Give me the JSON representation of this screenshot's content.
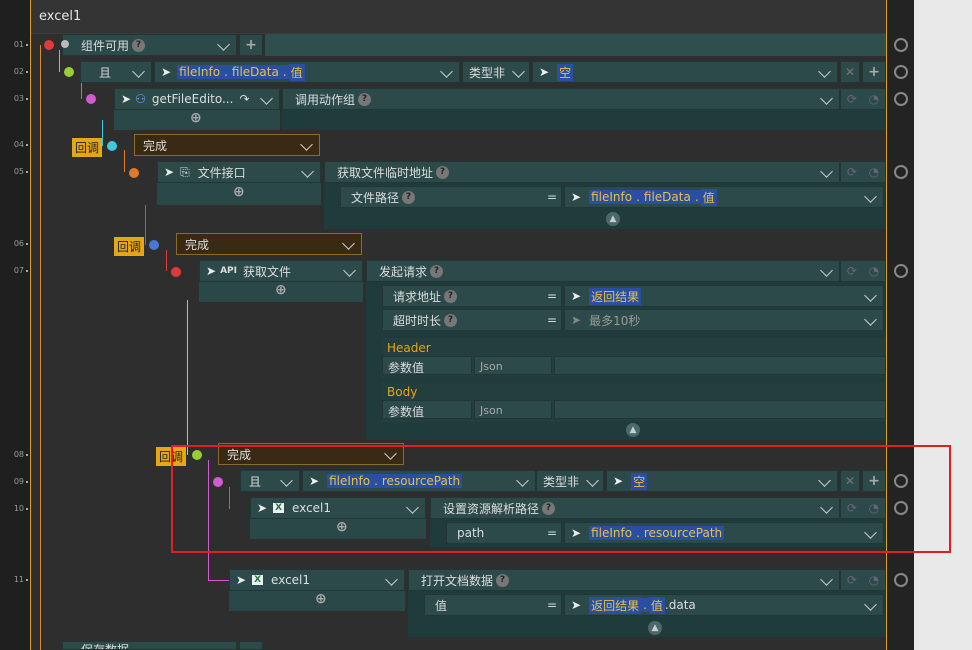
{
  "title": "excel1",
  "line_numbers": [
    "01",
    "02",
    "03",
    "04",
    "05",
    "06",
    "07",
    "08",
    "09",
    "10",
    "11"
  ],
  "rows": {
    "r01": {
      "label": "组件可用"
    },
    "r02": {
      "op": "且",
      "field_a": "fileInfo",
      "field_b": "fileData",
      "field_c": "值",
      "type": "类型非",
      "value": "空"
    },
    "r03": {
      "name": "getFileEdito...",
      "action": "调用动作组"
    },
    "r04": {
      "callback": "回调",
      "label": "完成"
    },
    "r05": {
      "name": "文件接口",
      "action": "获取文件临时地址",
      "param_label": "文件路径",
      "eq": "=",
      "val_a": "fileInfo",
      "val_b": "fileData",
      "val_c": "值"
    },
    "r06": {
      "callback": "回调",
      "label": "完成"
    },
    "r07": {
      "api": "API",
      "name": "获取文件",
      "action": "发起请求",
      "url_label": "请求地址",
      "url_value": "返回结果",
      "timeout_label": "超时时长",
      "timeout_placeholder": "最多10秒",
      "header_title": "Header",
      "header_param": "参数值",
      "header_type": "Json",
      "body_title": "Body",
      "body_param": "参数值",
      "body_type": "Json"
    },
    "r08": {
      "callback": "回调",
      "label": "完成"
    },
    "r09": {
      "op": "且",
      "field_a": "fileInfo",
      "field_b": "resourcePath",
      "type": "类型非",
      "value": "空"
    },
    "r10": {
      "name": "excel1",
      "action": "设置资源解析路径",
      "param_label": "path",
      "eq": "=",
      "val_a": "fileInfo",
      "val_b": "resourcePath"
    },
    "r11": {
      "name": "excel1",
      "action": "打开文档数据",
      "param_label": "值",
      "eq": "=",
      "val_a": "返回结果",
      "val_b": "值",
      "val_c": "data"
    },
    "r12": {
      "label": "保存数据"
    }
  },
  "colors": {
    "accent": "#e7a615",
    "highlight_box": "#e02020",
    "panel": "#2d4a4a"
  }
}
